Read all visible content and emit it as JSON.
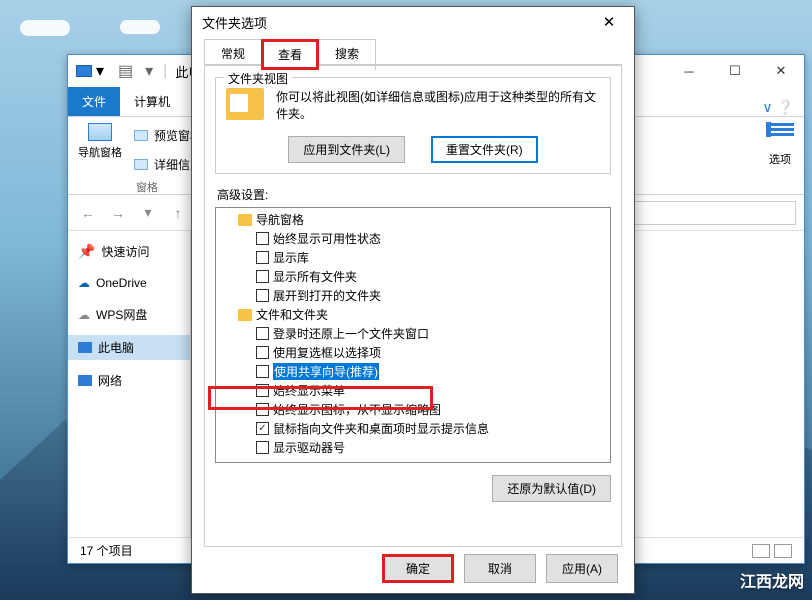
{
  "explorer": {
    "titlePrefix": "此电",
    "tabs": {
      "file": "文件",
      "computer": "计算机"
    },
    "ribbon": {
      "navPane": "导航窗格",
      "previewPane": "预览窗格",
      "detailsPane": "详细信息窗",
      "panesGroup": "窗格",
      "options": "选项"
    },
    "sidebar": {
      "quickAccess": "快速访问",
      "oneDrive": "OneDrive",
      "wps": "WPS网盘",
      "thisPC": "此电脑",
      "network": "网络"
    },
    "status": "17 个项目"
  },
  "dialog": {
    "title": "文件夹选项",
    "tabs": {
      "general": "常规",
      "view": "查看",
      "search": "搜索"
    },
    "folderViews": {
      "groupTitle": "文件夹视图",
      "desc": "你可以将此视图(如详细信息或图标)应用于这种类型的所有文件夹。",
      "applyBtn": "应用到文件夹(L)",
      "resetBtn": "重置文件夹(R)"
    },
    "advancedLabel": "高级设置:",
    "tree": {
      "navPane": "导航窗格",
      "items": [
        "始终显示可用性状态",
        "显示库",
        "显示所有文件夹",
        "展开到打开的文件夹"
      ],
      "filesFolders": "文件和文件夹",
      "items2": [
        "登录时还原上一个文件夹窗口",
        "使用复选框以选择项",
        "使用共享向导(推荐)",
        "始终显示菜单",
        "始终显示图标，从不显示缩略图",
        "鼠标指向文件夹和桌面项时显示提示信息",
        "显示驱动器号"
      ]
    },
    "restoreDefaults": "还原为默认值(D)",
    "buttons": {
      "ok": "确定",
      "cancel": "取消",
      "apply": "应用(A)"
    }
  },
  "watermark": "江西龙网"
}
